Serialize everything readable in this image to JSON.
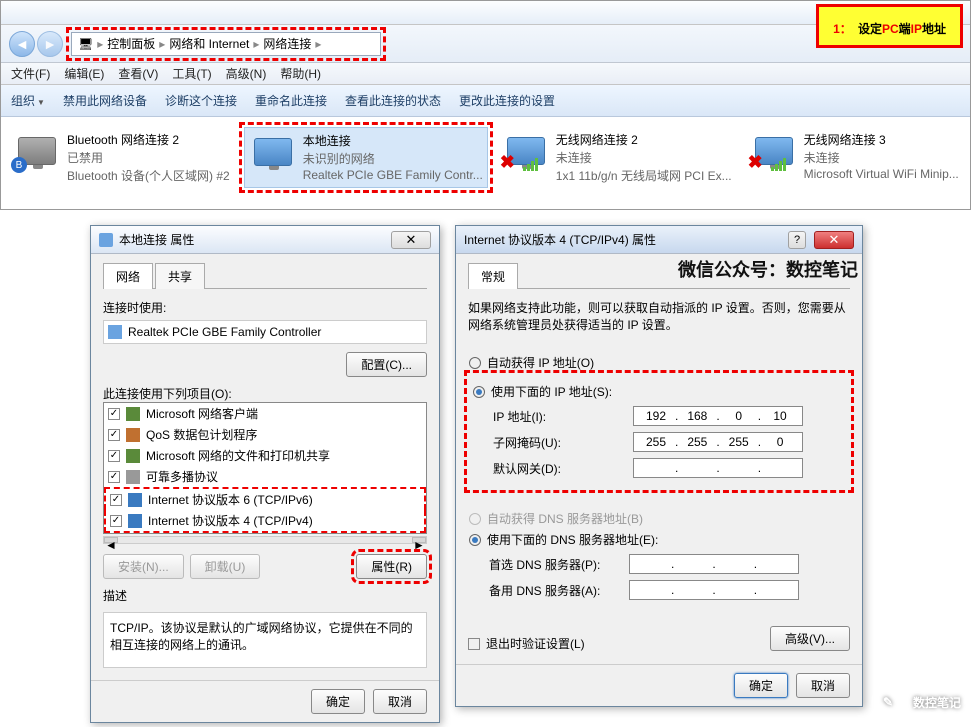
{
  "banner": {
    "num": "1",
    "colon": "：",
    "pre": "设定",
    "pc": "PC",
    "mid": "端",
    "ip": "IP",
    "post": "地址"
  },
  "breadcrumb": {
    "icon": "pc",
    "p1": "控制面板",
    "p2": "网络和 Internet",
    "p3": "网络连接"
  },
  "menu": {
    "file": "文件(F)",
    "edit": "编辑(E)",
    "view": "查看(V)",
    "tools": "工具(T)",
    "adv": "高级(N)",
    "help": "帮助(H)"
  },
  "toolbar": {
    "org": "组织",
    "disable": "禁用此网络设备",
    "diag": "诊断这个连接",
    "rename": "重命名此连接",
    "status": "查看此连接的状态",
    "change": "更改此连接的设置"
  },
  "connections": [
    {
      "name": "Bluetooth 网络连接 2",
      "status": "已禁用",
      "dev": "Bluetooth 设备(个人区域网) #2",
      "type": "bt"
    },
    {
      "name": "本地连接",
      "status": "未识别的网络",
      "dev": "Realtek PCIe GBE Family Contr...",
      "type": "lan",
      "selected": true
    },
    {
      "name": "无线网络连接 2",
      "status": "未连接",
      "dev": "1x1 11b/g/n 无线局域网 PCI Ex...",
      "type": "wifi",
      "x": true
    },
    {
      "name": "无线网络连接 3",
      "status": "未连接",
      "dev": "Microsoft Virtual WiFi Minip...",
      "type": "wifi",
      "x": true
    }
  ],
  "props": {
    "title": "本地连接 属性",
    "tabs": {
      "net": "网络",
      "share": "共享"
    },
    "connect_using": "连接时使用:",
    "adapter": "Realtek PCIe GBE Family Controller",
    "configure": "配置(C)...",
    "uses_items": "此连接使用下列项目(O):",
    "items": [
      {
        "chk": true,
        "label": "Microsoft 网络客户端",
        "color": "#5a8a3a"
      },
      {
        "chk": true,
        "label": "QoS 数据包计划程序",
        "color": "#c07030"
      },
      {
        "chk": true,
        "label": "Microsoft 网络的文件和打印机共享",
        "color": "#5a8a3a"
      },
      {
        "chk": true,
        "label": "可靠多播协议",
        "color": "#999"
      },
      {
        "chk": true,
        "label": "Internet 协议版本 6 (TCP/IPv6)",
        "color": "#3a7ac0"
      },
      {
        "chk": true,
        "label": "Internet 协议版本 4 (TCP/IPv4)",
        "color": "#3a7ac0",
        "hl": true
      }
    ],
    "install": "安装(N)...",
    "uninstall": "卸载(U)",
    "properties": "属性(R)",
    "desc_label": "描述",
    "desc_text": "TCP/IP。该协议是默认的广域网络协议，它提供在不同的相互连接的网络上的通讯。",
    "ok": "确定",
    "cancel": "取消"
  },
  "ipv4": {
    "title": "Internet 协议版本 4 (TCP/IPv4) 属性",
    "wechat": "微信公众号：数控笔记",
    "tab": "常规",
    "info": "如果网络支持此功能，则可以获取自动指派的 IP 设置。否则，您需要从网络系统管理员处获得适当的 IP 设置。",
    "auto_ip": "自动获得 IP 地址(O)",
    "use_ip": "使用下面的 IP 地址(S):",
    "ip_label": "IP 地址(I):",
    "ip": [
      "192",
      "168",
      "0",
      "10"
    ],
    "mask_label": "子网掩码(U):",
    "mask": [
      "255",
      "255",
      "255",
      "0"
    ],
    "gw_label": "默认网关(D):",
    "gw": [
      "",
      "",
      "",
      ""
    ],
    "auto_dns": "自动获得 DNS 服务器地址(B)",
    "use_dns": "使用下面的 DNS 服务器地址(E):",
    "dns1_label": "首选 DNS 服务器(P):",
    "dns1": [
      "",
      "",
      "",
      ""
    ],
    "dns2_label": "备用 DNS 服务器(A):",
    "dns2": [
      "",
      "",
      "",
      ""
    ],
    "validate": "退出时验证设置(L)",
    "advanced": "高级(V)...",
    "ok": "确定",
    "cancel": "取消"
  },
  "watermark": "数控笔记"
}
